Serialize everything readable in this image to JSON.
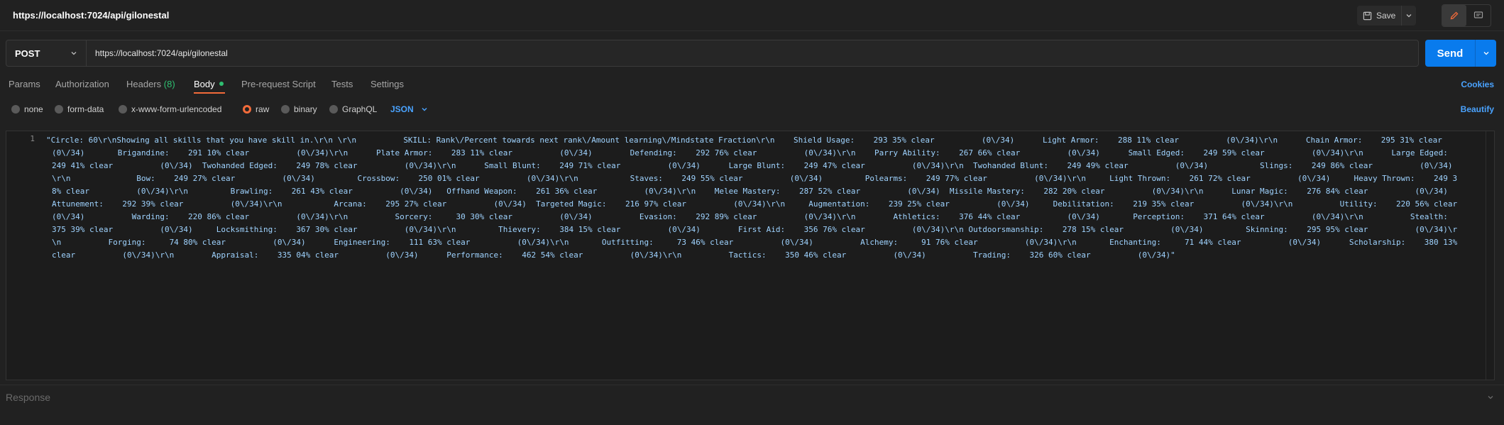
{
  "header": {
    "title": "https://localhost:7024/api/gilonestal",
    "save_label": "Save"
  },
  "request": {
    "method": "POST",
    "url": "https://localhost:7024/api/gilonestal",
    "send_label": "Send"
  },
  "tabs": [
    {
      "label": "Params"
    },
    {
      "label": "Authorization"
    },
    {
      "label": "Headers",
      "count": "(8)"
    },
    {
      "label": "Body"
    },
    {
      "label": "Pre-request Script"
    },
    {
      "label": "Tests"
    },
    {
      "label": "Settings"
    }
  ],
  "cookies_label": "Cookies",
  "body_options": [
    "none",
    "form-data",
    "x-www-form-urlencoded",
    "raw",
    "binary",
    "GraphQL"
  ],
  "body_format": "JSON",
  "beautify_label": "Beautify",
  "editor": {
    "line_number": "1",
    "content": "\"Circle: 60\\r\\nShowing all skills that you have skill in.\\r\\n \\r\\n          SKILL: Rank\\/Percent towards next rank\\/Amount learning\\/Mindstate Fraction\\r\\n    Shield Usage:    293 35% clear          (0\\/34)      Light Armor:    288 11% clear          (0\\/34)\\r\\n      Chain Armor:    295 31% clear          (0\\/34)       Brigandine:    291 10% clear          (0\\/34)\\r\\n      Plate Armor:    283 11% clear          (0\\/34)        Defending:    292 76% clear          (0\\/34)\\r\\n    Parry Ability:    267 66% clear          (0\\/34)      Small Edged:    249 59% clear          (0\\/34)\\r\\n      Large Edged:    249 41% clear          (0\\/34)  Twohanded Edged:    249 78% clear          (0\\/34)\\r\\n      Small Blunt:    249 71% clear          (0\\/34)      Large Blunt:    249 47% clear          (0\\/34)\\r\\n  Twohanded Blunt:    249 49% clear          (0\\/34)           Slings:    249 86% clear          (0\\/34)\\r\\n              Bow:    249 27% clear          (0\\/34)         Crossbow:    250 01% clear          (0\\/34)\\r\\n           Staves:    249 55% clear          (0\\/34)         Polearms:    249 77% clear          (0\\/34)\\r\\n     Light Thrown:    261 72% clear          (0\\/34)     Heavy Thrown:    249 38% clear          (0\\/34)\\r\\n         Brawling:    261 43% clear          (0\\/34)   Offhand Weapon:    261 36% clear          (0\\/34)\\r\\n    Melee Mastery:    287 52% clear          (0\\/34)  Missile Mastery:    282 20% clear          (0\\/34)\\r\\n      Lunar Magic:    276 84% clear          (0\\/34)       Attunement:    292 39% clear          (0\\/34)\\r\\n           Arcana:    295 27% clear          (0\\/34)  Targeted Magic:    216 97% clear          (0\\/34)\\r\\n     Augmentation:    239 25% clear          (0\\/34)     Debilitation:    219 35% clear          (0\\/34)\\r\\n          Utility:    220 56% clear          (0\\/34)          Warding:    220 86% clear          (0\\/34)\\r\\n          Sorcery:     30 30% clear          (0\\/34)          Evasion:    292 89% clear          (0\\/34)\\r\\n        Athletics:    376 44% clear          (0\\/34)       Perception:    371 64% clear          (0\\/34)\\r\\n          Stealth:    375 39% clear          (0\\/34)     Locksmithing:    367 30% clear          (0\\/34)\\r\\n         Thievery:    384 15% clear          (0\\/34)        First Aid:    356 76% clear          (0\\/34)\\r\\n Outdoorsmanship:    278 15% clear          (0\\/34)         Skinning:    295 95% clear          (0\\/34)\\r\\n          Forging:     74 80% clear          (0\\/34)      Engineering:    111 63% clear          (0\\/34)\\r\\n       Outfitting:     73 46% clear          (0\\/34)          Alchemy:     91 76% clear          (0\\/34)\\r\\n       Enchanting:     71 44% clear          (0\\/34)      Scholarship:    380 13% clear          (0\\/34)\\r\\n        Appraisal:    335 04% clear          (0\\/34)      Performance:    462 54% clear          (0\\/34)\\r\\n          Tactics:    350 46% clear          (0\\/34)          Trading:    326 60% clear          (0\\/34)\""
  },
  "response_label": "Response"
}
